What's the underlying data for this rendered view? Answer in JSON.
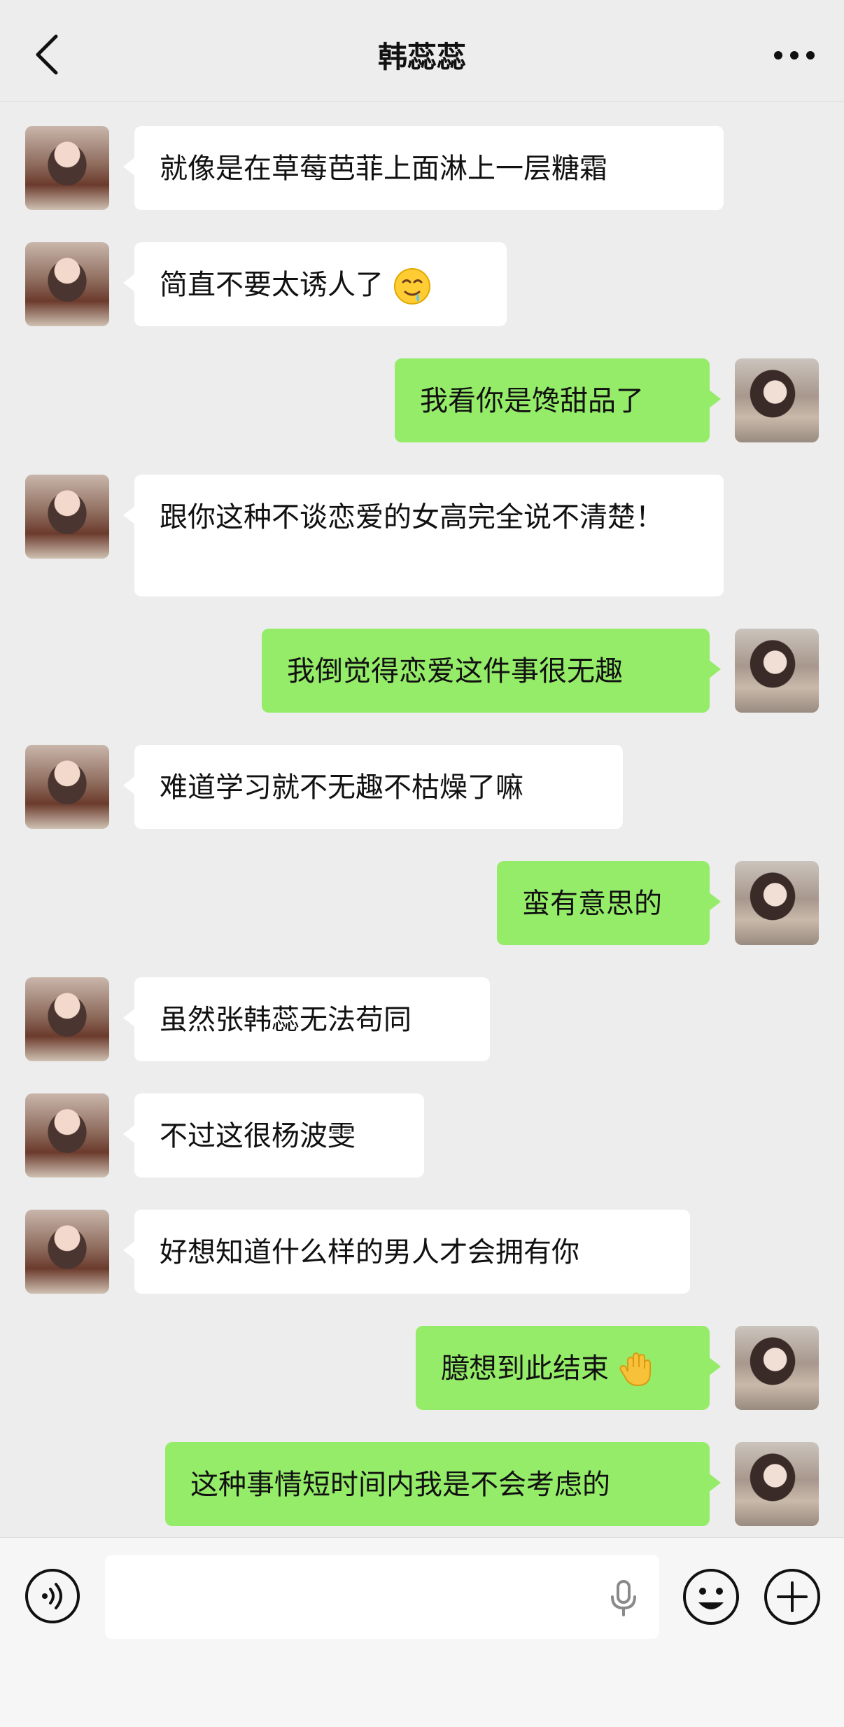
{
  "header": {
    "title": "韩蕊蕊",
    "back_icon": "chevron-left-icon",
    "more_icon": "ellipsis-icon"
  },
  "messages": [
    {
      "side": "in",
      "text": "就像是在草莓芭菲上面淋上一层糖霜"
    },
    {
      "side": "in",
      "text": "简直不要太诱人了",
      "emoji": "drooling-face-icon"
    },
    {
      "side": "out",
      "text": "我看你是馋甜品了"
    },
    {
      "side": "in",
      "text": "跟你这种不谈恋爱的女高完全说不清楚！"
    },
    {
      "side": "out",
      "text": "我倒觉得恋爱这件事很无趣"
    },
    {
      "side": "in",
      "text": "难道学习就不无趣不枯燥了嘛"
    },
    {
      "side": "out",
      "text": "蛮有意思的"
    },
    {
      "side": "in",
      "text": "虽然张韩蕊无法苟同"
    },
    {
      "side": "in",
      "text": "不过这很杨波雯"
    },
    {
      "side": "in",
      "text": "好想知道什么样的男人才会拥有你"
    },
    {
      "side": "out",
      "text": "臆想到此结束",
      "emoji": "raised-hand-icon"
    },
    {
      "side": "out",
      "text": "这种事情短时间内我是不会考虑的"
    }
  ],
  "input_bar": {
    "voice_icon": "voice-mode-icon",
    "mic_icon": "microphone-icon",
    "emoji_icon": "smiley-icon",
    "plus_icon": "plus-circle-icon",
    "input_value": ""
  },
  "colors": {
    "background": "#ededed",
    "incoming_bubble": "#ffffff",
    "outgoing_bubble": "#95ec69",
    "text": "#111111"
  }
}
